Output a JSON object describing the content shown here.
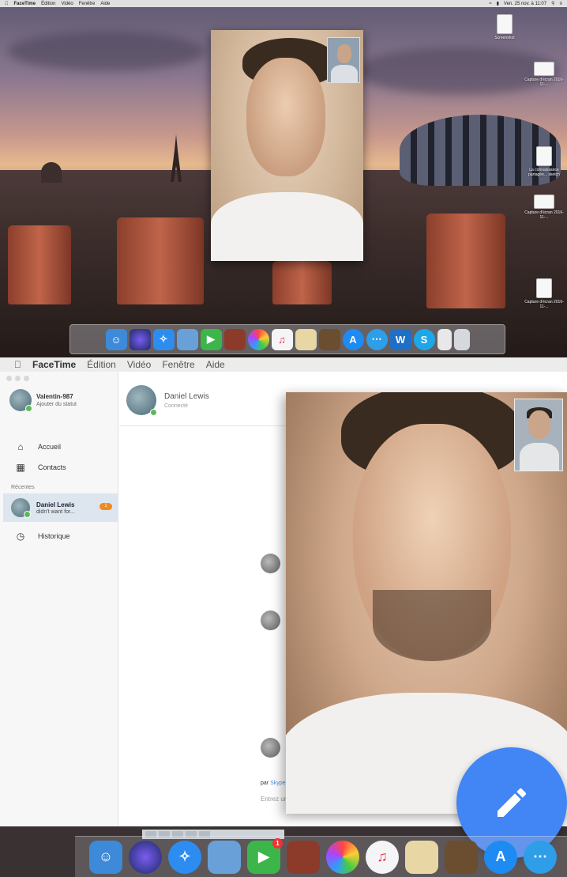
{
  "top": {
    "menubar": {
      "app": "FaceTime",
      "items": [
        "Édition",
        "Vidéo",
        "Fenêtre",
        "Aide"
      ],
      "clock": "Ven. 25 nov. à 11:07"
    },
    "desktop_icons": [
      {
        "label": "Screenshot",
        "icon": "document-icon"
      },
      {
        "label": "Capture d'écran 2016-11-...",
        "icon": "screenshot-icon"
      },
      {
        "label": "La connaissance partagée... sketch",
        "icon": "document-icon"
      },
      {
        "label": "Capture d'écran 2016-11-...",
        "icon": "screenshot-icon"
      },
      {
        "label": "Capture d'écran 2016-11-...",
        "icon": "screenshot-icon"
      }
    ]
  },
  "bottom": {
    "menubar": {
      "app": "FaceTime",
      "items": [
        "Édition",
        "Vidéo",
        "Fenêtre",
        "Aide"
      ]
    },
    "sidebar": {
      "user": {
        "name": "Valentin-987",
        "status": "Ajouter du statut"
      },
      "nav": [
        {
          "label": "Accueil",
          "icon": "home-icon"
        },
        {
          "label": "Contacts",
          "icon": "contacts-icon"
        }
      ],
      "section_label": "Récentes",
      "conversation": {
        "name": "Daniel Lewis",
        "preview": "didn't want for...",
        "badge": "1"
      },
      "history": {
        "label": "Historique",
        "icon": "clock-icon"
      }
    },
    "chat": {
      "contact_name": "Daniel Lewis",
      "contact_status": "Connecté",
      "by_prefix": "par",
      "by_link": "Skype",
      "input_placeholder": "Entrez un message"
    }
  },
  "colors": {
    "fab": "#4285f4",
    "badge": "#f08a1c",
    "online": "#5cb85c",
    "selected_row": "#dde6ee"
  }
}
